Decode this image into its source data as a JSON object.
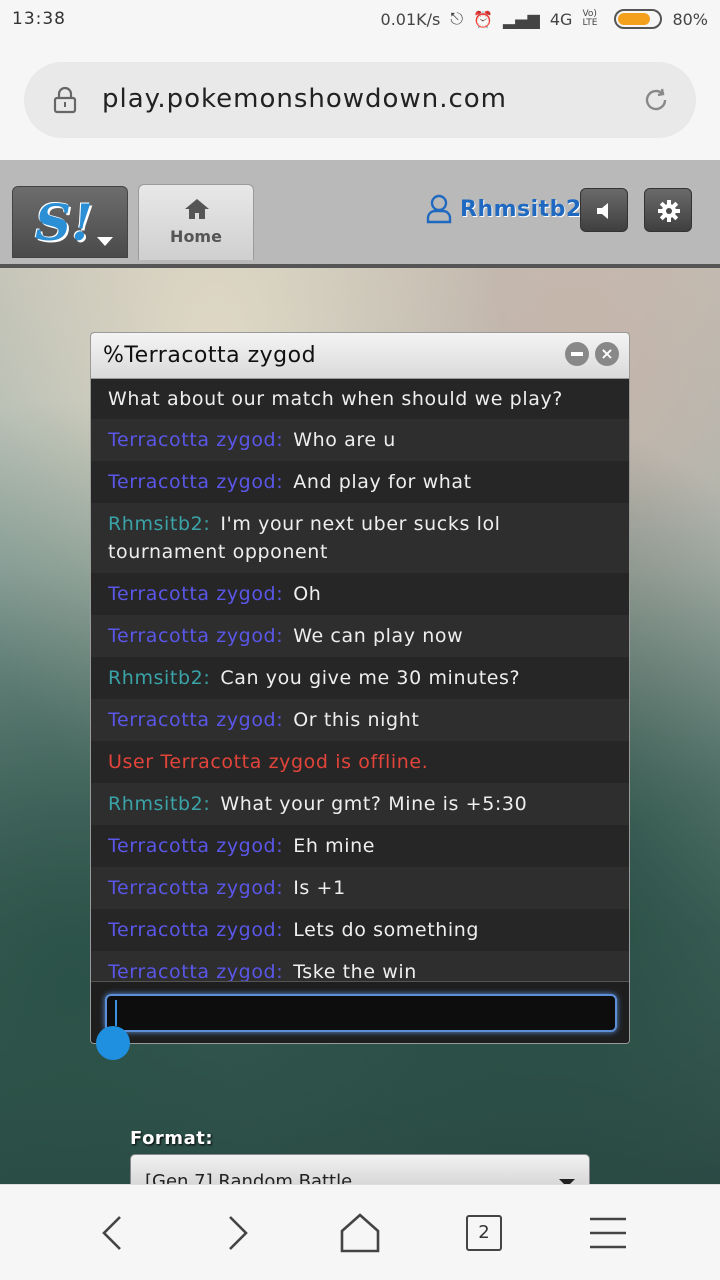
{
  "status_bar": {
    "time": "13:38",
    "net_speed": "0.01K/s",
    "network": "4G",
    "volte": "Vo) LTE",
    "battery": "80%",
    "battery_level": 0.8
  },
  "browser": {
    "url": "play.pokemonshowdown.com"
  },
  "header": {
    "home_tab": "Home",
    "username": "Rhmsitb2"
  },
  "pm": {
    "title": "%Terracotta zygod",
    "messages": [
      {
        "name": "Rhmsitb2:",
        "text": "What about our match when should we play?",
        "kind": "rh"
      },
      {
        "name": "Terracotta zygod:",
        "text": "Who are u",
        "kind": "tz"
      },
      {
        "name": "Terracotta zygod:",
        "text": "And play for what",
        "kind": "tz"
      },
      {
        "name": "Rhmsitb2:",
        "text": "I'm your next uber sucks lol tournament opponent",
        "kind": "rh"
      },
      {
        "name": "Terracotta zygod:",
        "text": "Oh",
        "kind": "tz"
      },
      {
        "name": "Terracotta zygod:",
        "text": "We can play now",
        "kind": "tz"
      },
      {
        "name": "Rhmsitb2:",
        "text": "Can you give me 30 minutes?",
        "kind": "rh"
      },
      {
        "name": "Terracotta zygod:",
        "text": "Or this night",
        "kind": "tz"
      },
      {
        "name": "",
        "text": "User Terracotta zygod is offline.",
        "kind": "sys"
      },
      {
        "name": "Rhmsitb2:",
        "text": "What your gmt? Mine is +5:30",
        "kind": "rh"
      },
      {
        "name": "Terracotta zygod:",
        "text": "Eh mine",
        "kind": "tz"
      },
      {
        "name": "Terracotta zygod:",
        "text": "Is +1",
        "kind": "tz"
      },
      {
        "name": "Terracotta zygod:",
        "text": "Lets do something",
        "kind": "tz"
      },
      {
        "name": "Terracotta zygod:",
        "text": "Tske the win",
        "kind": "tz"
      }
    ],
    "input_value": ""
  },
  "format": {
    "label": "Format:",
    "value": "[Gen 7] Random Battle"
  },
  "bottom_nav": {
    "tab_count": "2"
  },
  "colors": {
    "tz_name": "#5a57e8",
    "rh_name": "#3aa3a8",
    "system": "#e2443a",
    "accent": "#1f8fe0"
  }
}
